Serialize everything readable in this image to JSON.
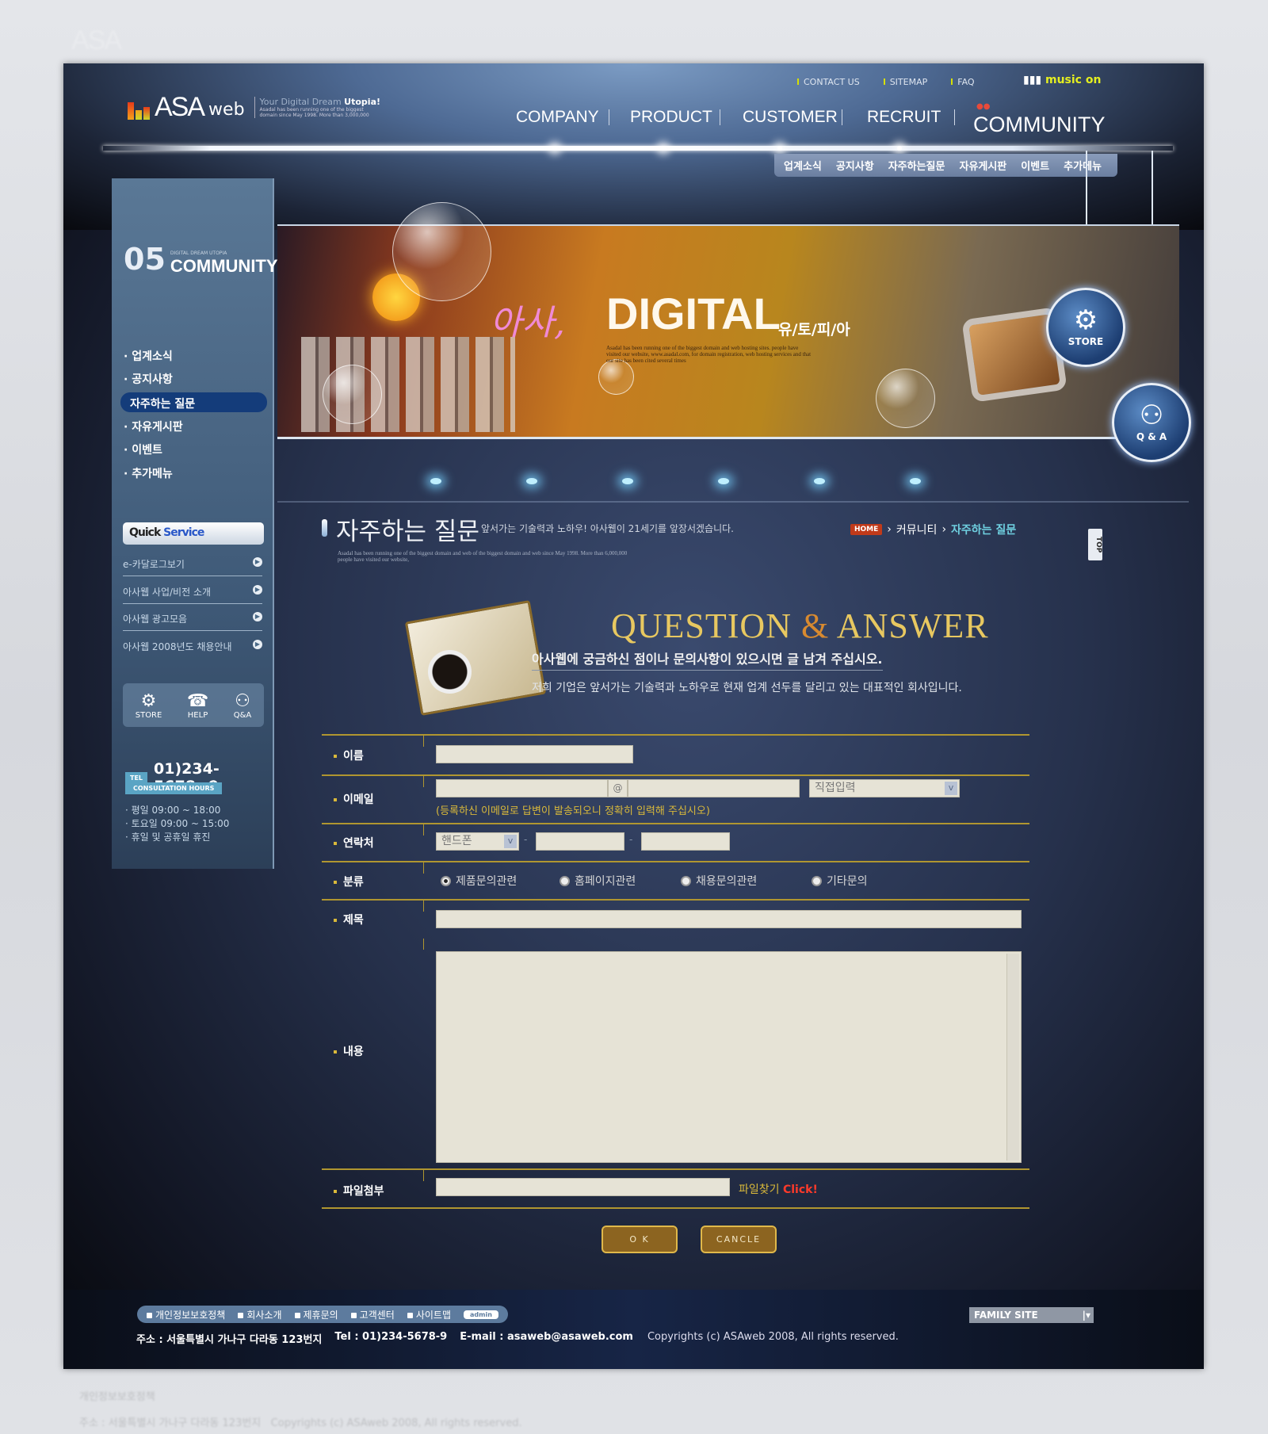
{
  "brand": {
    "logo": "ASA",
    "logo_sub": "web",
    "tagline": "Your Digital Dream",
    "tagline_bold": "Utopia!",
    "tagline_small": "Asadal has been running one of the biggest domain since May 1998. More than 3,000,000"
  },
  "top_links": [
    "CONTACT US",
    "SITEMAP",
    "FAQ"
  ],
  "music": "music on",
  "nav": [
    "COMPANY",
    "PRODUCT",
    "CUSTOMER",
    "RECRUIT",
    "COMMUNITY"
  ],
  "subnav": [
    "업계소식",
    "공지사항",
    "자주하는질문",
    "자유게시판",
    "이벤트",
    "추가메뉴"
  ],
  "sidebar": {
    "section_no": "05",
    "section_title": "COMMUNITY",
    "section_small": "DIGITAL DREAM UTOPIA",
    "items": [
      "업계소식",
      "공지사항",
      "자주하는 질문",
      "자유게시판",
      "이벤트",
      "추가메뉴"
    ],
    "active_index": 2,
    "quick_title": "Quick",
    "quick_title_accent": "Service",
    "quick_items": [
      "e-카달로그보기",
      "아사웹 사업/비전 소개",
      "아사웹 광고모음",
      "아사웹 2008년도 채용안내"
    ],
    "icons": [
      "STORE",
      "HELP",
      "Q&A"
    ],
    "tel_label": "TEL",
    "tel": "01)234-5678~9",
    "hours_label": "CONSULTATION HOURS",
    "hours": [
      "평일 09:00 ~ 18:00",
      "토요일 09:00 ~ 15:00",
      "휴일 및 공휴일 휴진"
    ]
  },
  "banner": {
    "script": "아사,",
    "title": "DIGITAL",
    "suffix": "유/토/피/아",
    "small": "Asadal has been running one of the biggest domain and web hosting sites. people have visited our website, www.asadal.com, for domain registration, web hosting services and that our site has been cited several times",
    "store": "STORE",
    "qa": "Q & A"
  },
  "page": {
    "title": "자주하는 질문",
    "subtitle": "앞서가는 기술력과 노하우! 아사웹이 21세기를 앞장서겠습니다.",
    "desc": "Asadal has been running one of the biggest domain and web of the biggest domain and web since May 1998. More than 6,000,000 people have visited our website,",
    "breadcrumb": {
      "home": "HOME",
      "parent": "커뮤니티",
      "current": "자주하는 질문"
    },
    "top": "TOP"
  },
  "qa": {
    "title_a": "QUESTION",
    "amp": "&",
    "title_b": "ANSWER",
    "line1": "아사웹에 궁금하신 점이나 문의사항이 있으시면 글 남겨 주십시오.",
    "line2": "저희 기업은 앞서가는 기술력과 노하우로 현재 업계 선두를 달리고 있는 대표적인 회사입니다."
  },
  "form": {
    "name_label": "이름",
    "email_label": "이메일",
    "email_at": "@",
    "email_domain_select": "직접입력",
    "email_note": "(등록하신 이메일로 답변이 발송되오니 정확히 입력해 주십시오)",
    "phone_label": "연락처",
    "phone_select": "핸드폰",
    "dash": "-",
    "category_label": "분류",
    "categories": [
      "제품문의관련",
      "홈페이지관련",
      "채용문의관련",
      "기타문의"
    ],
    "selected_category": 0,
    "subject_label": "제목",
    "content_label": "내용",
    "file_label": "파일첨부",
    "file_find": "파일찾기",
    "file_click": "Click!",
    "ok": "O K",
    "cancel": "CANCLE"
  },
  "footer": {
    "links": [
      "개인정보보호정책",
      "회사소개",
      "제휴문의",
      "고객센터",
      "사이트맵"
    ],
    "admin": "admin",
    "address": "주소 : 서울특별시 가나구 다라동 123번지",
    "tel": "Tel : 01)234-5678-9",
    "email": "E-mail : asaweb@asaweb.com",
    "copyright": "Copyrights (c) ASAweb 2008, All rights reserved.",
    "family_site": "FAMILY SITE"
  },
  "colors": {
    "accent_gold": "#d9b93a",
    "form_line": "#b09630",
    "active_menu": "#143c7a",
    "click": "#ff3a2a",
    "breadcrumb_current": "#6fd0e0"
  }
}
